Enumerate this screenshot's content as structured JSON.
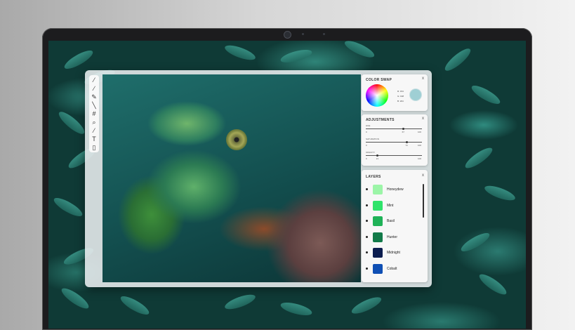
{
  "tools": [
    "wand-icon",
    "brush-icon",
    "pencil-icon",
    "line-icon",
    "crop-icon",
    "zoom-icon",
    "dropper-icon",
    "text-icon",
    "eraser-icon"
  ],
  "color_swap": {
    "title": "COLOR SWAP",
    "close": "x",
    "r_label": "R:",
    "r_value": "154",
    "g_label": "G:",
    "g_value": "198",
    "b_label": "B:",
    "b_value": "204",
    "swatch_color": "#9fcfd4"
  },
  "adjustments": {
    "title": "ADJUSTMENTS",
    "close": "x",
    "sliders": [
      {
        "label": "HUE",
        "min": "0",
        "value": "67",
        "max": "100",
        "level": 0.67
      },
      {
        "label": "SATURATION",
        "min": "0",
        "value": "73",
        "max": "100",
        "level": 0.73
      },
      {
        "label": "OPACITY",
        "min": "0",
        "value": "21",
        "max": "100",
        "level": 0.21
      }
    ]
  },
  "layers": {
    "title": "LAYERS",
    "close": "x",
    "items": [
      {
        "name": "Honeydew",
        "color": "#9cf5a8"
      },
      {
        "name": "Mint",
        "color": "#2ee36a"
      },
      {
        "name": "Basil",
        "color": "#1fb257"
      },
      {
        "name": "Hunter",
        "color": "#127a49"
      },
      {
        "name": "Midnight",
        "color": "#0c1d4f"
      },
      {
        "name": "Cobalt",
        "color": "#0f4fb4"
      }
    ]
  }
}
